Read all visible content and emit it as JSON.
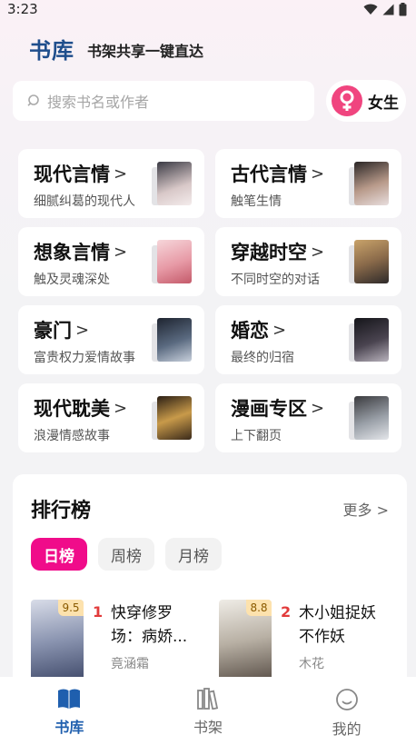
{
  "status_bar": {
    "time": "3:23"
  },
  "header": {
    "brand": "书库",
    "slogan": "书架共享一键直达"
  },
  "search": {
    "placeholder": "搜索书名或作者"
  },
  "gender_switch": {
    "label": "女生"
  },
  "categories": [
    {
      "title": "现代言情",
      "subtitle": "细腻纠葛的现代人"
    },
    {
      "title": "古代言情",
      "subtitle": "触笔生情"
    },
    {
      "title": "想象言情",
      "subtitle": "触及灵魂深处"
    },
    {
      "title": "穿越时空",
      "subtitle": "不同时空的对话"
    },
    {
      "title": "豪门",
      "subtitle": "富贵权力爱情故事"
    },
    {
      "title": "婚恋",
      "subtitle": "最终的归宿"
    },
    {
      "title": "现代耽美",
      "subtitle": "浪漫情感故事"
    },
    {
      "title": "漫画专区",
      "subtitle": "上下翻页"
    }
  ],
  "ranking": {
    "title": "排行榜",
    "more": "更多",
    "tabs": [
      {
        "label": "日榜"
      },
      {
        "label": "周榜"
      },
      {
        "label": "月榜"
      }
    ],
    "books": [
      {
        "rank": "1",
        "score": "9.5",
        "title": "快穿修罗场：病娇...",
        "author": "竟涵霜"
      },
      {
        "rank": "2",
        "score": "8.8",
        "title": "木小姐捉妖不作妖",
        "author": "木花"
      }
    ]
  },
  "tabbar": [
    {
      "label": "书库"
    },
    {
      "label": "书架"
    },
    {
      "label": "我的"
    }
  ],
  "colors": {
    "accent": "#f00c8a",
    "brand": "#1f4e8c",
    "tab_active": "#1f5fae",
    "gender": "#f0457f",
    "rank_number": "#e23b3b"
  }
}
